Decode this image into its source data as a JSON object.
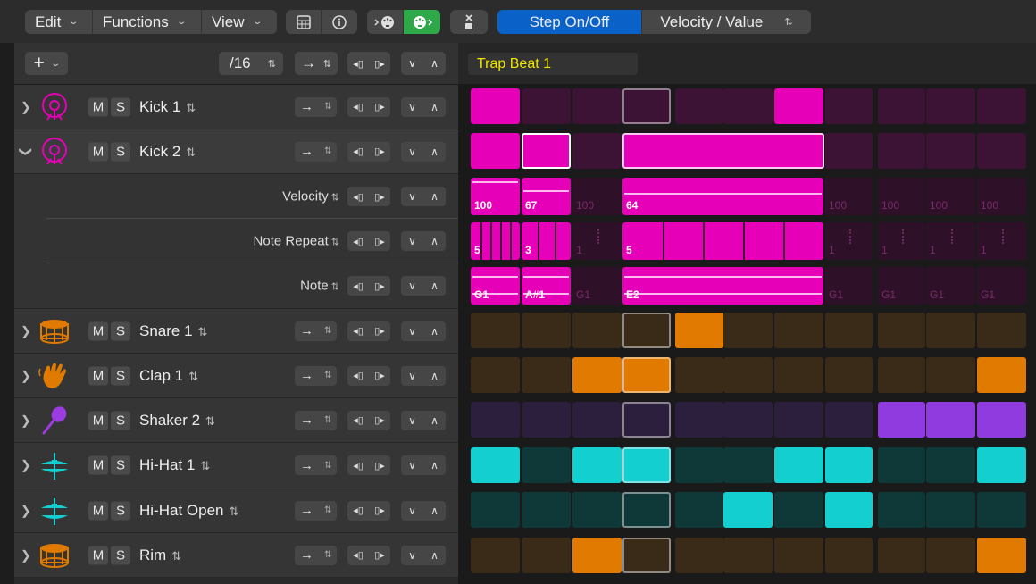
{
  "menu": {
    "edit": "Edit",
    "functions": "Functions",
    "view": "View"
  },
  "modes": {
    "step": "Step On/Off",
    "velocity": "Velocity / Value"
  },
  "pattern": {
    "resolution": "/16",
    "name": "Trap Beat 1"
  },
  "tracks": [
    {
      "name": "Kick 1",
      "icon": "kick-drum-icon",
      "color": "#e600b8"
    },
    {
      "name": "Kick 2",
      "icon": "kick-drum-icon",
      "color": "#e600b8",
      "expanded": true
    },
    {
      "name": "Snare 1",
      "icon": "snare-drum-icon",
      "color": "#e07a00"
    },
    {
      "name": "Clap 1",
      "icon": "clap-hand-icon",
      "color": "#e07a00"
    },
    {
      "name": "Shaker 2",
      "icon": "shaker-icon",
      "color": "#9b3be0"
    },
    {
      "name": "Hi-Hat 1",
      "icon": "hihat-icon",
      "color": "#13cfcf"
    },
    {
      "name": "Hi-Hat Open",
      "icon": "hihat-icon",
      "color": "#13cfcf"
    },
    {
      "name": "Rim",
      "icon": "snare-drum-icon",
      "color": "#e07a00"
    }
  ],
  "sublanes": {
    "velocity": "Velocity",
    "note_repeat": "Note Repeat",
    "note": "Note"
  },
  "mute": "M",
  "solo": "S",
  "lane_values": {
    "velocity": [
      "100",
      "67",
      "100",
      "64",
      "100",
      "100",
      "100",
      "100"
    ],
    "repeat": [
      "5",
      "3",
      "1",
      "5",
      "1",
      "1",
      "1",
      "1"
    ],
    "note": [
      "G1",
      "A#1",
      "G1",
      "E2",
      "G1",
      "G1",
      "G1",
      "G1"
    ]
  },
  "steps": {
    "kick1": [
      1,
      0,
      0,
      0,
      0,
      0,
      1,
      0,
      0,
      0,
      0
    ],
    "snare1": [
      0,
      0,
      0,
      0,
      1,
      0,
      0,
      0,
      0,
      0,
      0
    ],
    "clap1": [
      0,
      0,
      1,
      1,
      0,
      0,
      0,
      0,
      0,
      0,
      1
    ],
    "shaker2": [
      0,
      0,
      0,
      0,
      0,
      0,
      0,
      0,
      1,
      1,
      1
    ],
    "hihat1": [
      1,
      0,
      1,
      1,
      0,
      0,
      1,
      1,
      0,
      0,
      1
    ],
    "hihatopen": [
      0,
      0,
      0,
      0,
      0,
      1,
      0,
      1,
      0,
      0,
      0
    ],
    "rim": [
      0,
      0,
      1,
      0,
      0,
      0,
      0,
      0,
      0,
      0,
      1
    ]
  }
}
